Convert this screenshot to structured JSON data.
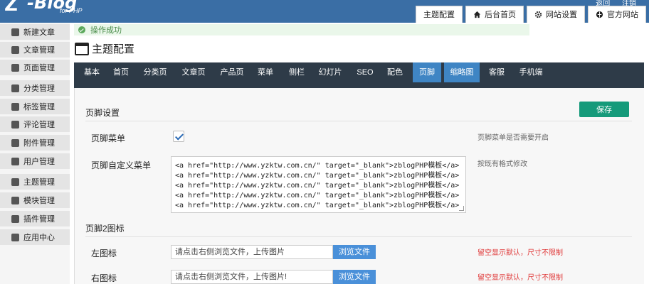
{
  "top": {
    "logo_mark": "Z",
    "logo_text": "-Blog",
    "logo_sub": "for PHP",
    "links": [
      "返回",
      "注销"
    ],
    "nav": [
      "主题配置",
      "后台首页",
      "网站设置",
      "官方网站"
    ]
  },
  "sidebar": {
    "items": [
      {
        "label": "新建文章",
        "icon": "edit-icon"
      },
      {
        "label": "文章管理",
        "icon": "article-icon"
      },
      {
        "label": "页面管理",
        "icon": "page-icon"
      },
      {
        "label": "分类管理",
        "icon": "folder-icon"
      },
      {
        "label": "标签管理",
        "icon": "tag-icon"
      },
      {
        "label": "评论管理",
        "icon": "comment-icon"
      },
      {
        "label": "附件管理",
        "icon": "attachment-icon"
      },
      {
        "label": "用户管理",
        "icon": "users-icon"
      },
      {
        "label": "主题管理",
        "icon": "theme-icon"
      },
      {
        "label": "模块管理",
        "icon": "module-icon"
      },
      {
        "label": "插件管理",
        "icon": "plugin-icon"
      },
      {
        "label": "应用中心",
        "icon": "app-center-icon"
      }
    ]
  },
  "alert": {
    "text": "操作成功"
  },
  "page": {
    "title": "主题配置"
  },
  "tabs": [
    "基本",
    "首页",
    "分类页",
    "文章页",
    "产品页",
    "菜单",
    "侧栏",
    "幻灯片",
    "SEO",
    "配色",
    "页脚",
    "缩略图",
    "客服",
    "手机端"
  ],
  "form": {
    "footer_section": "页脚设置",
    "save_label": "保存",
    "footer_menu_label": "页脚菜单",
    "footer_menu_desc": "页脚菜单是否需要开启",
    "custom_menu_label": "页脚自定义菜单",
    "custom_menu_desc": "按既有格式修改",
    "custom_menu_value": "<a href=\"http://www.yzktw.com.cn/\" target=\"_blank\">zblogPHP模板</a>\n<a href=\"http://www.yzktw.com.cn/\" target=\"_blank\">zblogPHP模板</a>\n<a href=\"http://www.yzktw.com.cn/\" target=\"_blank\">zblogPHP模板</a>\n<a href=\"http://www.yzktw.com.cn/\" target=\"_blank\">zblogPHP模板</a>\n<a href=\"http://www.yzktw.com.cn/\" target=\"_blank\">zblogPHP模板</a>",
    "footer2_section": "页脚2图标",
    "left_icon_label": "左图标",
    "left_icon_placeholder": "请点击右侧浏览文件，上传图片",
    "left_icon_desc": "留空显示默认，尺寸不限制",
    "right_icon_label": "右图标",
    "right_icon_placeholder": "请点击右侧浏览文件，上传图片!",
    "right_icon_desc": "留空显示默认，尺寸不限制",
    "browse_label": "浏览文件"
  }
}
